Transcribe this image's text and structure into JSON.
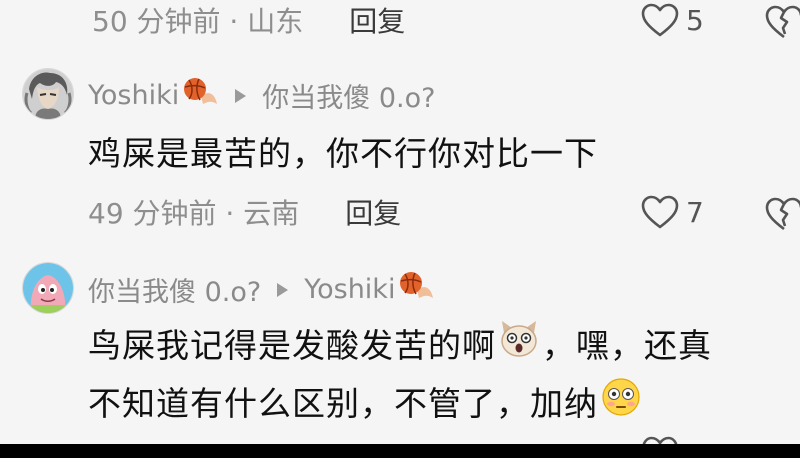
{
  "comments": [
    {
      "meta": {
        "time_location": "50 分钟前 · 山东",
        "reply_label": "回复",
        "like_count": "5"
      }
    },
    {
      "author": "Yoshiki",
      "reply_to": "你当我傻 0.o?",
      "text_lines": [
        "鸡屎是最苦的，你不行你对比一下"
      ],
      "meta": {
        "time_location": "49 分钟前 · 云南",
        "reply_label": "回复",
        "like_count": "7"
      }
    },
    {
      "author": "你当我傻 0.o?",
      "reply_to": "Yoshiki",
      "text_line_1a": "鸟屎我记得是发酸发苦的啊",
      "text_line_1b": "，嘿，还真",
      "text_line_2": "不知道有什么区别，不管了，加纳"
    }
  ],
  "icons": {
    "like": "heart-outline-icon",
    "dislike": "broken-heart-icon",
    "reply_arrow": "triangle-right-icon",
    "badge": "basketball-flame-icon",
    "emoji_1": "shocked-cat-emoji",
    "emoji_2": "flushed-face-emoji"
  },
  "colors": {
    "background": "#f5f5f5",
    "meta_text": "#8e8e8e",
    "main_text": "#111111",
    "accent_badge": "#e2622b"
  }
}
